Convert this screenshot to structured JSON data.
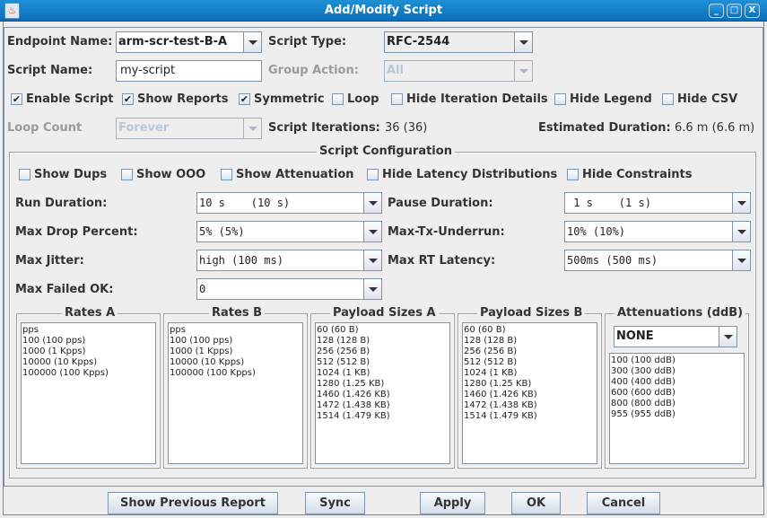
{
  "window": {
    "title": "Add/Modify Script",
    "icons": {
      "app": "java-app-icon",
      "minimize": "minimize-icon",
      "maximize": "maximize-icon",
      "close": "close-icon"
    },
    "minimize_glyph": "_",
    "maximize_glyph": "□",
    "close_glyph": "X",
    "app_glyph": "♨"
  },
  "header": {
    "endpoint_name": {
      "label": "Endpoint Name:",
      "value": "arm-scr-test-B-A"
    },
    "script_type": {
      "label": "Script Type:",
      "value": "RFC-2544"
    },
    "script_name": {
      "label": "Script Name:",
      "value": "my-script"
    },
    "group_action": {
      "label": "Group Action:",
      "value": "All",
      "disabled": true
    },
    "checkboxes": [
      {
        "label": "Enable Script",
        "checked": true
      },
      {
        "label": "Show Reports",
        "checked": true
      },
      {
        "label": "Symmetric",
        "checked": true
      },
      {
        "label": "Loop",
        "checked": false
      },
      {
        "label": "Hide Iteration Details",
        "checked": false
      },
      {
        "label": "Hide Legend",
        "checked": false
      },
      {
        "label": "Hide CSV",
        "checked": false
      }
    ],
    "loop_count": {
      "label": "Loop Count",
      "value": "Forever",
      "disabled": true
    },
    "script_iterations": {
      "label": "Script Iterations:",
      "value": "36 (36)"
    },
    "estimated_duration": {
      "label": "Estimated Duration:",
      "value": "6.6 m (6.6 m)"
    }
  },
  "config": {
    "title": "Script Configuration",
    "checkboxes": [
      {
        "label": "Show Dups",
        "checked": false
      },
      {
        "label": "Show OOO",
        "checked": false
      },
      {
        "label": "Show Attenuation",
        "checked": false
      },
      {
        "label": "Hide Latency Distributions",
        "checked": false
      },
      {
        "label": "Hide Constraints",
        "checked": false
      }
    ],
    "run_duration": {
      "label": "Run Duration:",
      "value": "10 s    (10 s)"
    },
    "pause_duration": {
      "label": "Pause Duration:",
      "value": " 1 s    (1 s)"
    },
    "max_drop_percent": {
      "label": "Max Drop Percent:",
      "value": "5% (5%)"
    },
    "max_tx_underrun": {
      "label": "Max-Tx-Underrun:",
      "value": "10% (10%)"
    },
    "max_jitter": {
      "label": "Max Jitter:",
      "value": "high (100 ms)"
    },
    "max_rt_latency": {
      "label": "Max RT Latency:",
      "value": "500ms (500 ms)"
    },
    "max_failed_ok": {
      "label": "Max Failed OK:",
      "value": "0"
    },
    "rates_a": {
      "title": "Rates A",
      "items": [
        "pps",
        "100 (100 pps)",
        "1000 (1 Kpps)",
        "10000 (10 Kpps)",
        "100000 (100 Kpps)"
      ]
    },
    "rates_b": {
      "title": "Rates B",
      "items": [
        "pps",
        "100 (100 pps)",
        "1000 (1 Kpps)",
        "10000 (10 Kpps)",
        "100000 (100 Kpps)"
      ]
    },
    "payload_a": {
      "title": "Payload Sizes A",
      "items": [
        "60 (60 B)",
        "128 (128 B)",
        "256 (256 B)",
        "512 (512 B)",
        "1024 (1 KB)",
        "1280 (1.25 KB)",
        "1460 (1.426 KB)",
        "1472 (1.438 KB)",
        "1514 (1.479 KB)"
      ]
    },
    "payload_b": {
      "title": "Payload Sizes B",
      "items": [
        "60 (60 B)",
        "128 (128 B)",
        "256 (256 B)",
        "512 (512 B)",
        "1024 (1 KB)",
        "1280 (1.25 KB)",
        "1460 (1.426 KB)",
        "1472 (1.438 KB)",
        "1514 (1.479 KB)"
      ]
    },
    "attenuations": {
      "title": "Attenuations (ddB)",
      "selected": "NONE",
      "items": [
        "100 (100 ddB)",
        "300 (300 ddB)",
        "400 (400 ddB)",
        "600 (600 ddB)",
        "800 (800 ddB)",
        "955 (955 ddB)"
      ]
    }
  },
  "buttons": {
    "show_previous_report": "Show Previous Report",
    "sync": "Sync",
    "apply": "Apply",
    "ok": "OK",
    "cancel": "Cancel"
  },
  "check_glyph": "✔"
}
